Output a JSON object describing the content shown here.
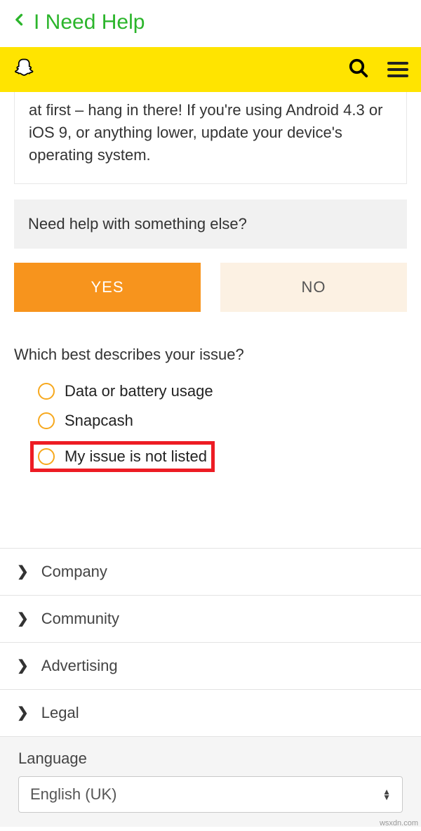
{
  "nav": {
    "title": "I Need Help"
  },
  "info_text": "at first – hang in there! If you're using Android 4.3 or iOS 9, or anything lower, update your device's operating system.",
  "prompt": "Need help with something else?",
  "buttons": {
    "yes": "YES",
    "no": "NO"
  },
  "question": "Which best describes your issue?",
  "options": {
    "o1": "Data or battery usage",
    "o2": "Snapcash",
    "o3": "My issue is not listed"
  },
  "footer": {
    "f1": "Company",
    "f2": "Community",
    "f3": "Advertising",
    "f4": "Legal"
  },
  "language": {
    "label": "Language",
    "value": "English (UK)"
  },
  "watermark": "wsxdn.com"
}
